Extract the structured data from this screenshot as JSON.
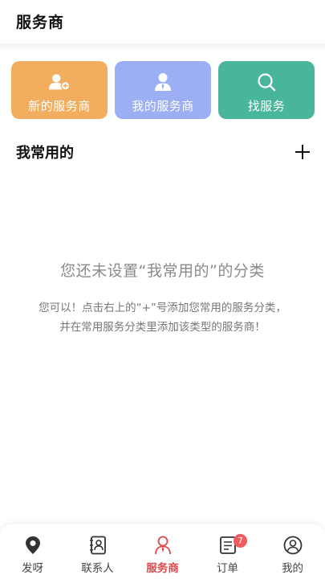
{
  "header": {
    "title": "服务商"
  },
  "cards": [
    {
      "label": "新的服务商",
      "icon": "add-person-icon",
      "color": "#f2ae5e"
    },
    {
      "label": "我的服务商",
      "icon": "person-tie-icon",
      "color": "#9caef4"
    },
    {
      "label": "找服务",
      "icon": "search-icon",
      "color": "#49b59b"
    }
  ],
  "section": {
    "title": "我常用的",
    "add_icon": "plus-icon"
  },
  "empty": {
    "title": "您还未设置“我常用的”的分类",
    "line1": "您可以！点击右上的“+”号添加您常用的服务分类，",
    "line2": "并在常用服务分类里添加该类型的服务商！"
  },
  "tabbar": {
    "items": [
      {
        "label": "发呀",
        "icon": "location-pin-icon"
      },
      {
        "label": "联系人",
        "icon": "contacts-icon"
      },
      {
        "label": "服务商",
        "icon": "provider-icon",
        "active": true
      },
      {
        "label": "订单",
        "icon": "orders-icon",
        "badge": "7"
      },
      {
        "label": "我的",
        "icon": "user-circle-icon"
      }
    ],
    "active_color": "#e2484a"
  }
}
